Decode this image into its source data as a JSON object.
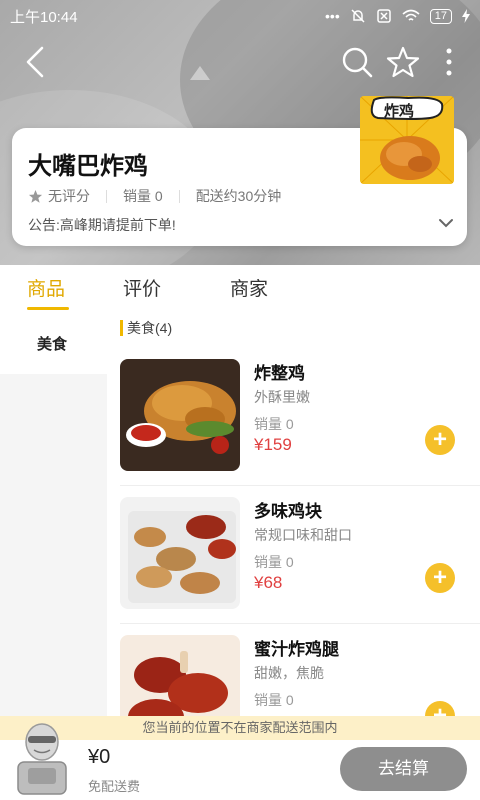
{
  "status_bar": {
    "time": "上午10:44",
    "battery": "17"
  },
  "nav": {
    "back_icon": "back-arrow-icon",
    "search_icon": "search-icon",
    "favorite_icon": "star-icon",
    "more_icon": "more-vertical-icon"
  },
  "shop": {
    "name": "大嘴巴炸鸡",
    "rating": "无评分",
    "sales": "销量 0",
    "delivery": "配送约30分钟",
    "notice": "公告:高峰期请提前下单!",
    "logo_text": "炸鸡"
  },
  "tabs": [
    {
      "label": "商品"
    },
    {
      "label": "评价"
    },
    {
      "label": "商家"
    }
  ],
  "categories": [
    {
      "label": "美食"
    }
  ],
  "section": {
    "title": "美食(4)"
  },
  "products": [
    {
      "name": "炸整鸡",
      "desc": "外酥里嫩",
      "sales": "销量 0",
      "price": "¥159"
    },
    {
      "name": "多味鸡块",
      "desc": "常规口味和甜口",
      "sales": "销量 0",
      "price": "¥68"
    },
    {
      "name": "蜜汁炸鸡腿",
      "desc": "甜嫩，焦脆",
      "sales": "销量 0",
      "price": ""
    }
  ],
  "warning": "您当前的位置不在商家配送范围内",
  "cart": {
    "total": "¥0",
    "delivery_fee": "免配送费",
    "checkout_label": "去结算"
  },
  "colors": {
    "accent": "#f0b800",
    "price": "#e04040",
    "add_button": "#f5c02a",
    "checkout_disabled": "#8e8e8e"
  }
}
